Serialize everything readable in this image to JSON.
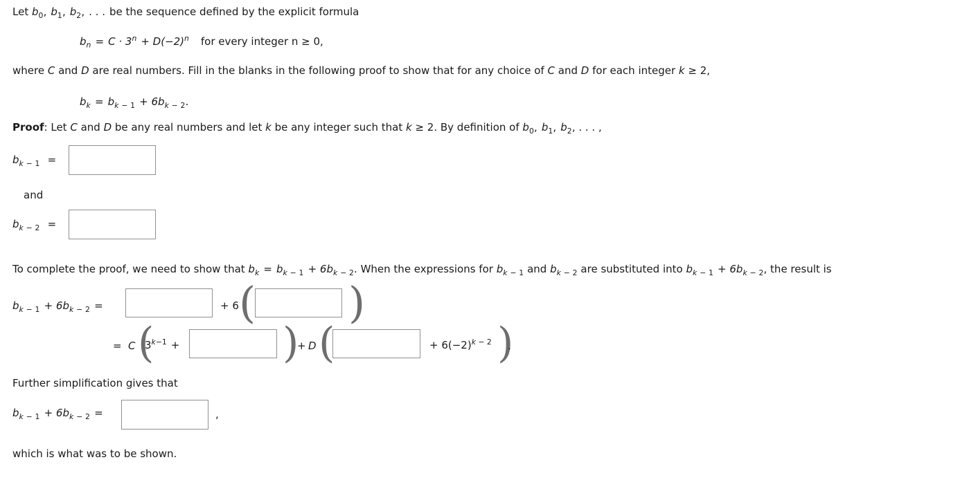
{
  "problem": {
    "intro_prefix": "Let ",
    "intro_b0": "b",
    "intro_sub0": "0",
    "intro_b1": "b",
    "intro_sub1": "1",
    "intro_b2": "b",
    "intro_sub2": "2",
    "intro_dots": ". . .",
    "intro_suffix": "be the sequence defined by the explicit formula",
    "formula": {
      "lhs_b": "b",
      "lhs_sub": "n",
      "eq": "=",
      "rhs": "C · 3",
      "exp1": "n",
      "plus": "+ D(−2)",
      "exp2": "n",
      "condition": "for every integer n ≥ 0,"
    },
    "where_line_a": "where ",
    "where_C": "C",
    "where_and": " and ",
    "where_D": "D",
    "where_line_b": " are real numbers. Fill in the blanks in the following proof to show that for any choice of ",
    "where_line_c": " for each integer ",
    "where_k": "k",
    "where_line_d": " ≥ 2,",
    "recurrence": {
      "b": "b",
      "sub_k": "k",
      "eq": "=",
      "b2": "b",
      "sub_km1_k": "k",
      "sub_km1_op": "−",
      "sub_km1_n": "1",
      "plus6b": "+ 6b",
      "sub_km2_k": "k",
      "sub_km2_op": "−",
      "sub_km2_n": "2",
      "period": "."
    },
    "proof_label": "Proof",
    "proof_text_1": ": Let ",
    "proof_text_2": " and ",
    "proof_text_3": " be any real numbers and let ",
    "proof_text_4": " be any integer such that ",
    "proof_text_5": " ≥ 2. By definition of ",
    "proof_text_dots": ", . . . ,"
  },
  "blanks": {
    "b_k_minus_1_label": {
      "b": "b",
      "k": "k",
      "op": "−",
      "n": "1",
      "eq": "="
    },
    "and_label": "and",
    "b_k_minus_2_label": {
      "b": "b",
      "k": "k",
      "op": "−",
      "n": "2",
      "eq": "="
    },
    "answer_1": "",
    "answer_1_placeholder": "",
    "answer_2": "",
    "answer_2_placeholder": "",
    "answer_3": "",
    "answer_4": "",
    "answer_5": "",
    "answer_6": "",
    "answer_7": ""
  },
  "completion": {
    "text_1": "To complete the proof, we need to show that ",
    "text_2": ". When the expressions for ",
    "text_3": " and ",
    "text_4": " are substituted into ",
    "text_5": ", the result is"
  },
  "equation_row1": {
    "plus6": "+ 6",
    "eq": "=",
    "open_paren": "(",
    "close_paren": ")"
  },
  "equation_row2": {
    "eq": "=",
    "C": "C",
    "three": "3",
    "three_exp_k": "k",
    "three_exp_op": "−",
    "three_exp_n": "1",
    "plus": "+",
    "D": "D",
    "plus6": "+ 6(−2)",
    "exp_k": "k",
    "exp_op": "−",
    "exp_n": "2",
    "period": ".",
    "open_paren": "(",
    "close_paren": ")"
  },
  "further": {
    "heading": "Further simplification gives that",
    "comma": ",",
    "closing": "which is what was to be shown."
  },
  "colors": {
    "text": "#1a1a1a",
    "box_border": "#909090",
    "background": "#ffffff",
    "paren": "#6e6e6e"
  }
}
